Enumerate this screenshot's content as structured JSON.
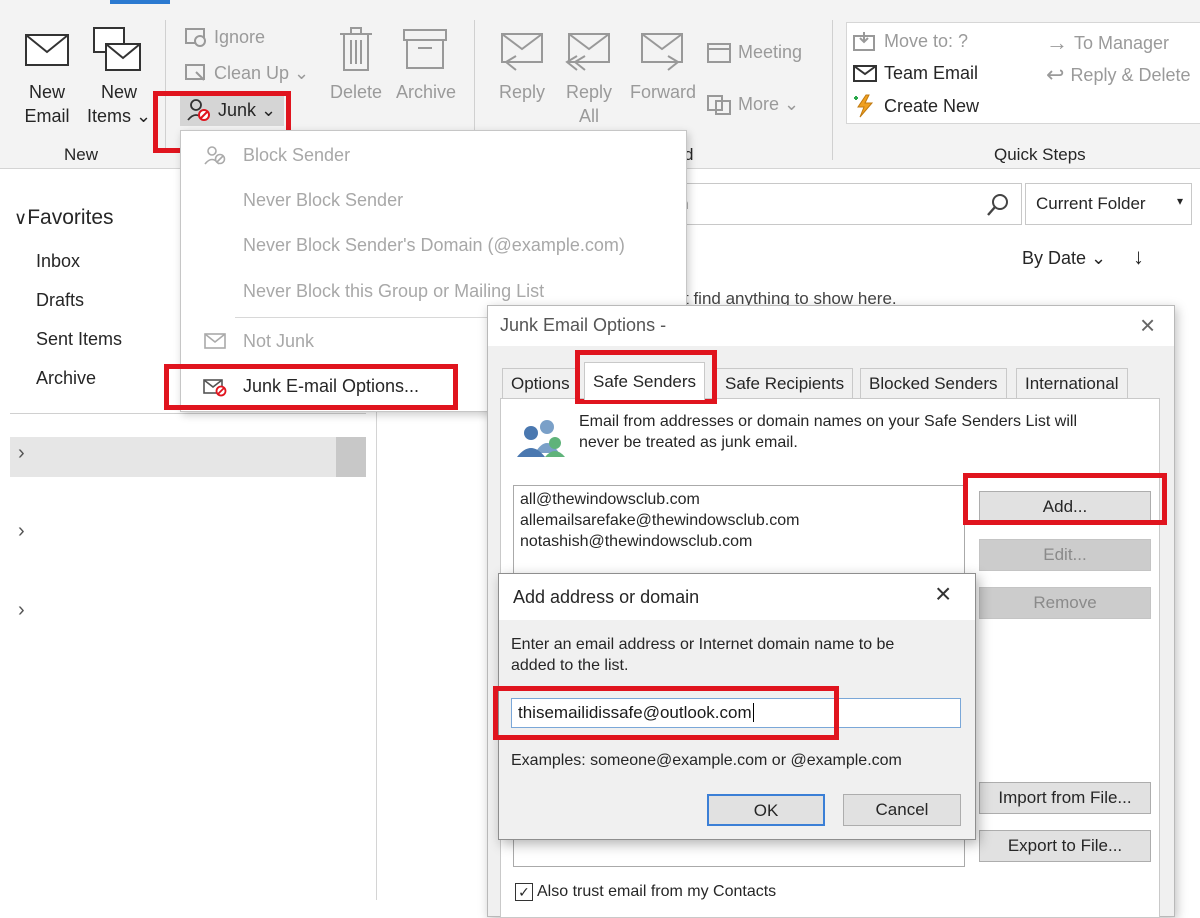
{
  "ribbon": {
    "new_email": [
      "New",
      "Email"
    ],
    "new_items": [
      "New",
      "Items ⌄"
    ],
    "group_new": "New",
    "ignore": "Ignore",
    "clean_up": "Clean Up ⌄",
    "junk": "Junk ⌄",
    "delete": "Delete",
    "archive": "Archive",
    "reply": "Reply",
    "reply_all": [
      "Reply",
      "All"
    ],
    "forward": "Forward",
    "meeting": "Meeting",
    "more": "More ⌄",
    "group_respond_tail": "d",
    "qs_move_to": "Move to: ?",
    "qs_team_email": "Team Email",
    "qs_create_new": "Create New",
    "qs_to_manager": "To Manager",
    "qs_reply_delete": "Reply & Delete",
    "group_quick_steps": "Quick Steps"
  },
  "nav": {
    "favorites": "Favorites",
    "items": [
      "Inbox",
      "Drafts",
      "Sent Items",
      "Archive"
    ]
  },
  "search": {
    "partial_text": "h",
    "scope": "Current Folder"
  },
  "list": {
    "sort": "By Date ⌄",
    "empty_partial": "t find anything to show here."
  },
  "junk_menu": {
    "block_sender": "Block Sender",
    "never_block_sender": "Never Block Sender",
    "never_block_domain": "Never Block Sender's Domain (@example.com)",
    "never_block_group": "Never Block this Group or Mailing List",
    "not_junk": "Not Junk",
    "junk_options": "Junk E-mail Options..."
  },
  "junk_dialog": {
    "title": "Junk Email Options -",
    "tabs": [
      "Options",
      "Safe Senders",
      "Safe Recipients",
      "Blocked Senders",
      "International"
    ],
    "description": [
      "Email from addresses or domain names on your Safe Senders List will",
      "never be treated as junk email."
    ],
    "safe_senders": [
      "all@thewindowsclub.com",
      "allemailsarefake@thewindowsclub.com",
      "notashish@thewindowsclub.com"
    ],
    "add": "Add...",
    "edit": "Edit...",
    "remove": "Remove",
    "import": "Import from File...",
    "export": "Export to File...",
    "trust_contacts": "Also trust email from my Contacts"
  },
  "add_dialog": {
    "title": "Add address or domain",
    "prompt": [
      "Enter an email address or Internet domain name to be",
      "added to the list."
    ],
    "value": "thisemailidissafe@outlook.com",
    "examples": "Examples: someone@example.com or @example.com",
    "ok": "OK",
    "cancel": "Cancel"
  },
  "colors": {
    "highlight": "#e0141e",
    "accent": "#2b79d0"
  }
}
